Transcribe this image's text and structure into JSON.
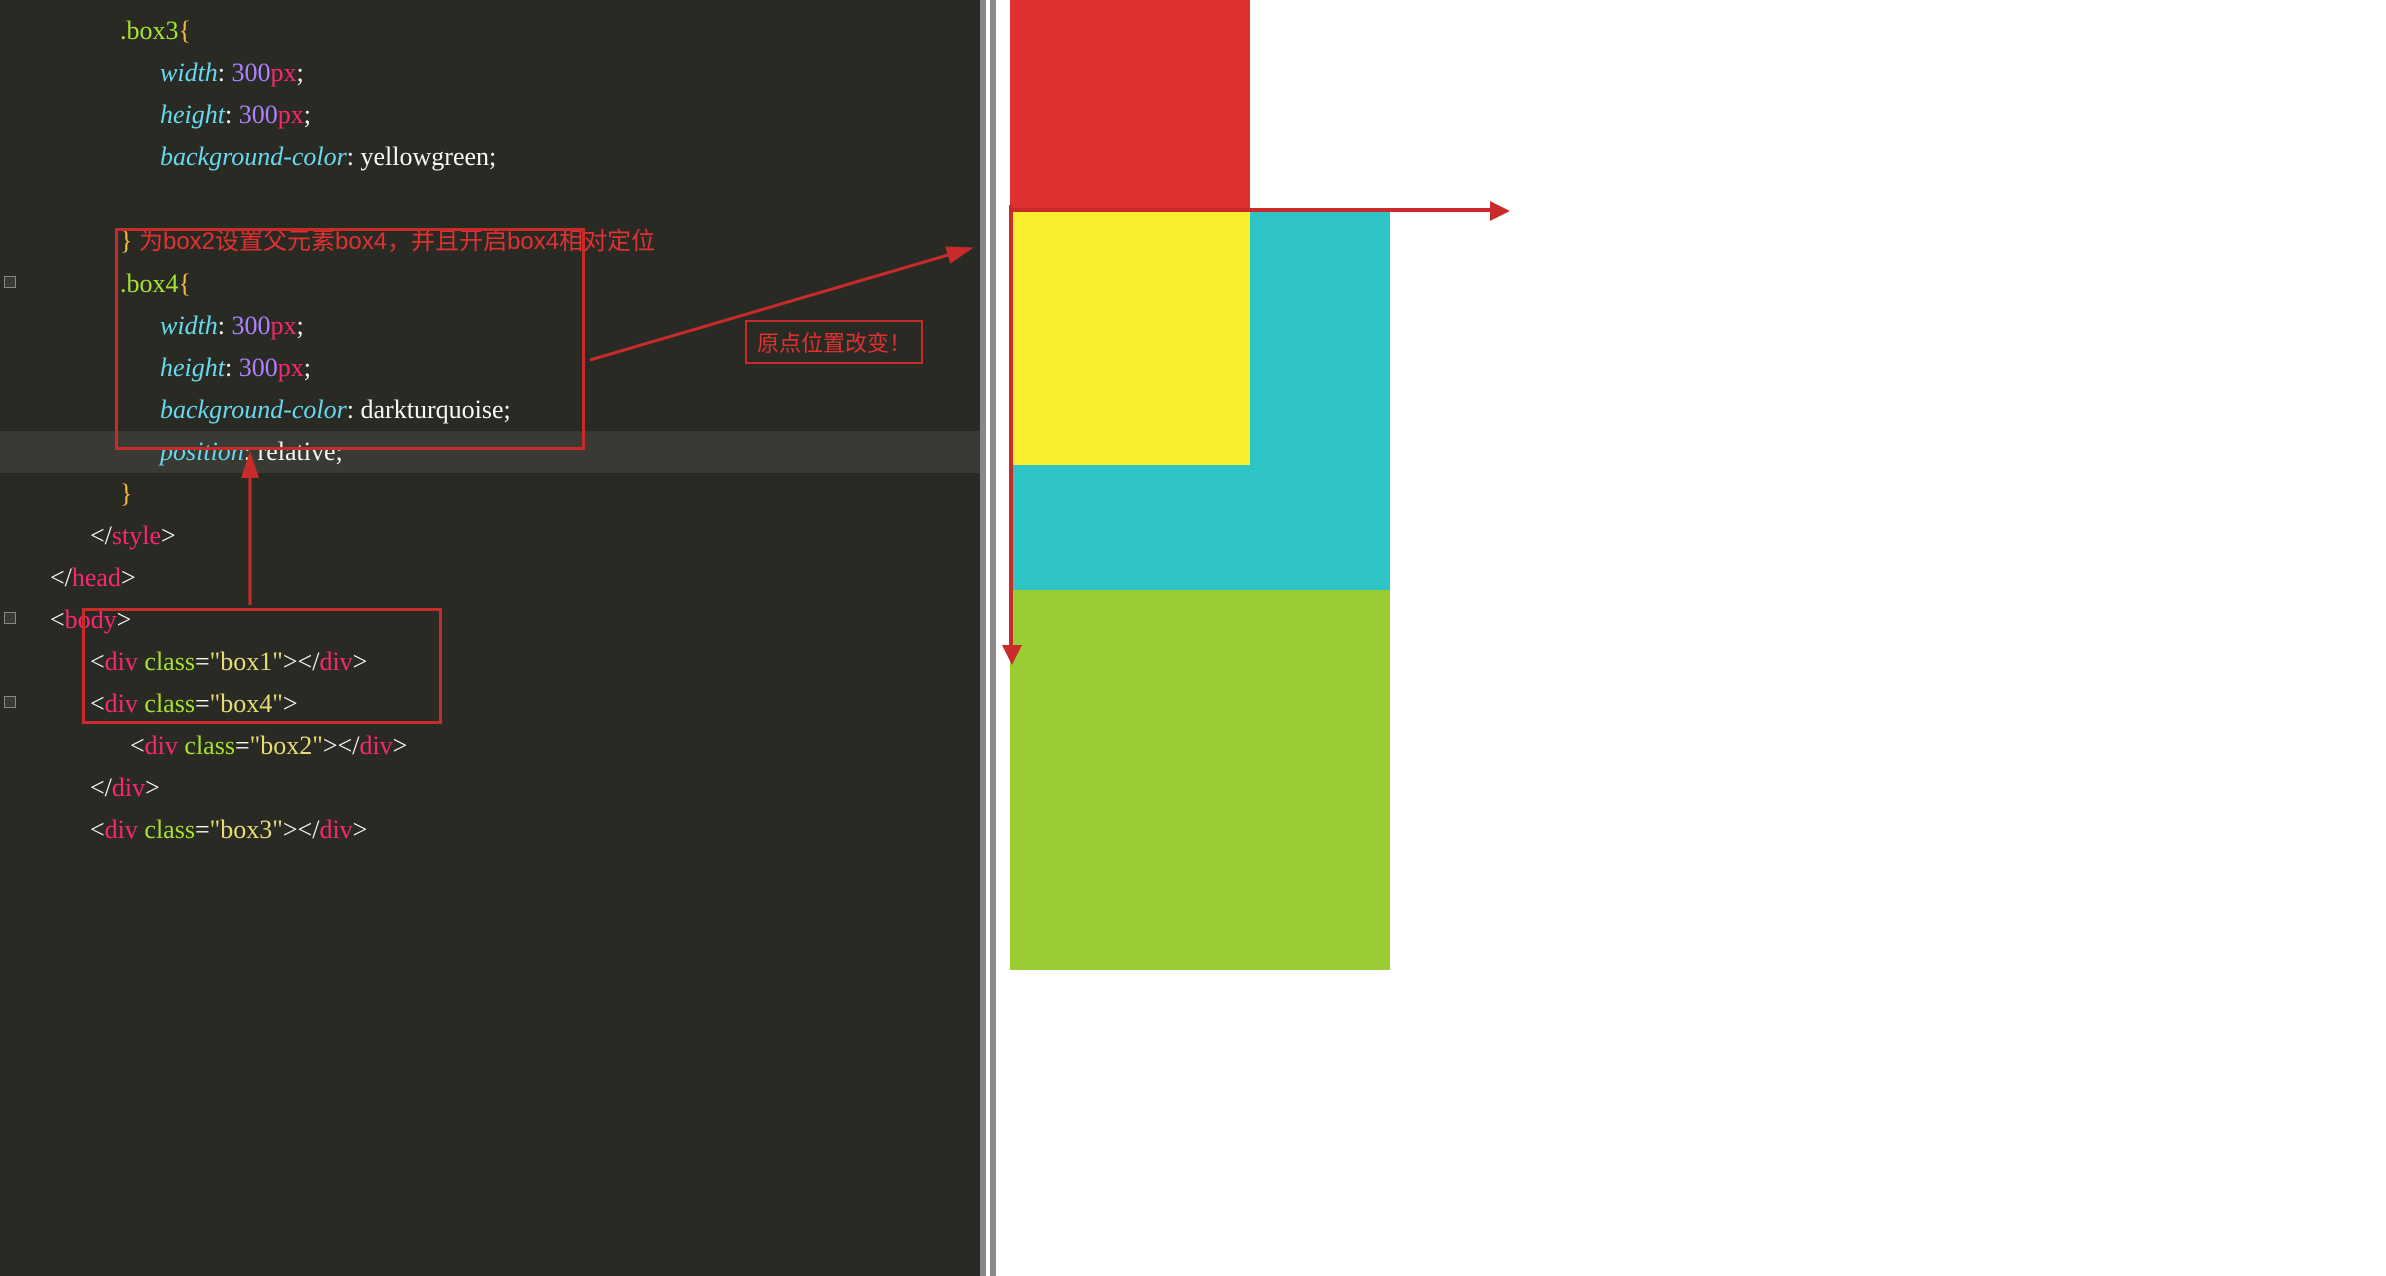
{
  "code": {
    "box3_sel": ".box3",
    "box4_sel": ".box4",
    "prop_width": "width",
    "prop_height": "height",
    "prop_bg": "background-color",
    "prop_pos": "position",
    "val_300": "300",
    "val_px": "px",
    "val_yellowgreen": "yellowgreen",
    "val_darkturquoise": "darkturquoise",
    "val_relative": "relative",
    "tag_style": "style",
    "tag_head": "head",
    "tag_body": "body",
    "tag_div": "div",
    "attr_class": "class",
    "cls_box1": "box1",
    "cls_box2": "box2",
    "cls_box3": "box3",
    "cls_box4": "box4"
  },
  "annotations": {
    "comment_box4": "为box2设置父元素box4，并且开启box4相对定位",
    "origin_changed": "原点位置改变！"
  },
  "preview": {
    "box1_color": "#e03131",
    "box2_color": "#f9ed2d",
    "box3_color": "#9acd32",
    "box4_color": "#2ec4c6"
  }
}
